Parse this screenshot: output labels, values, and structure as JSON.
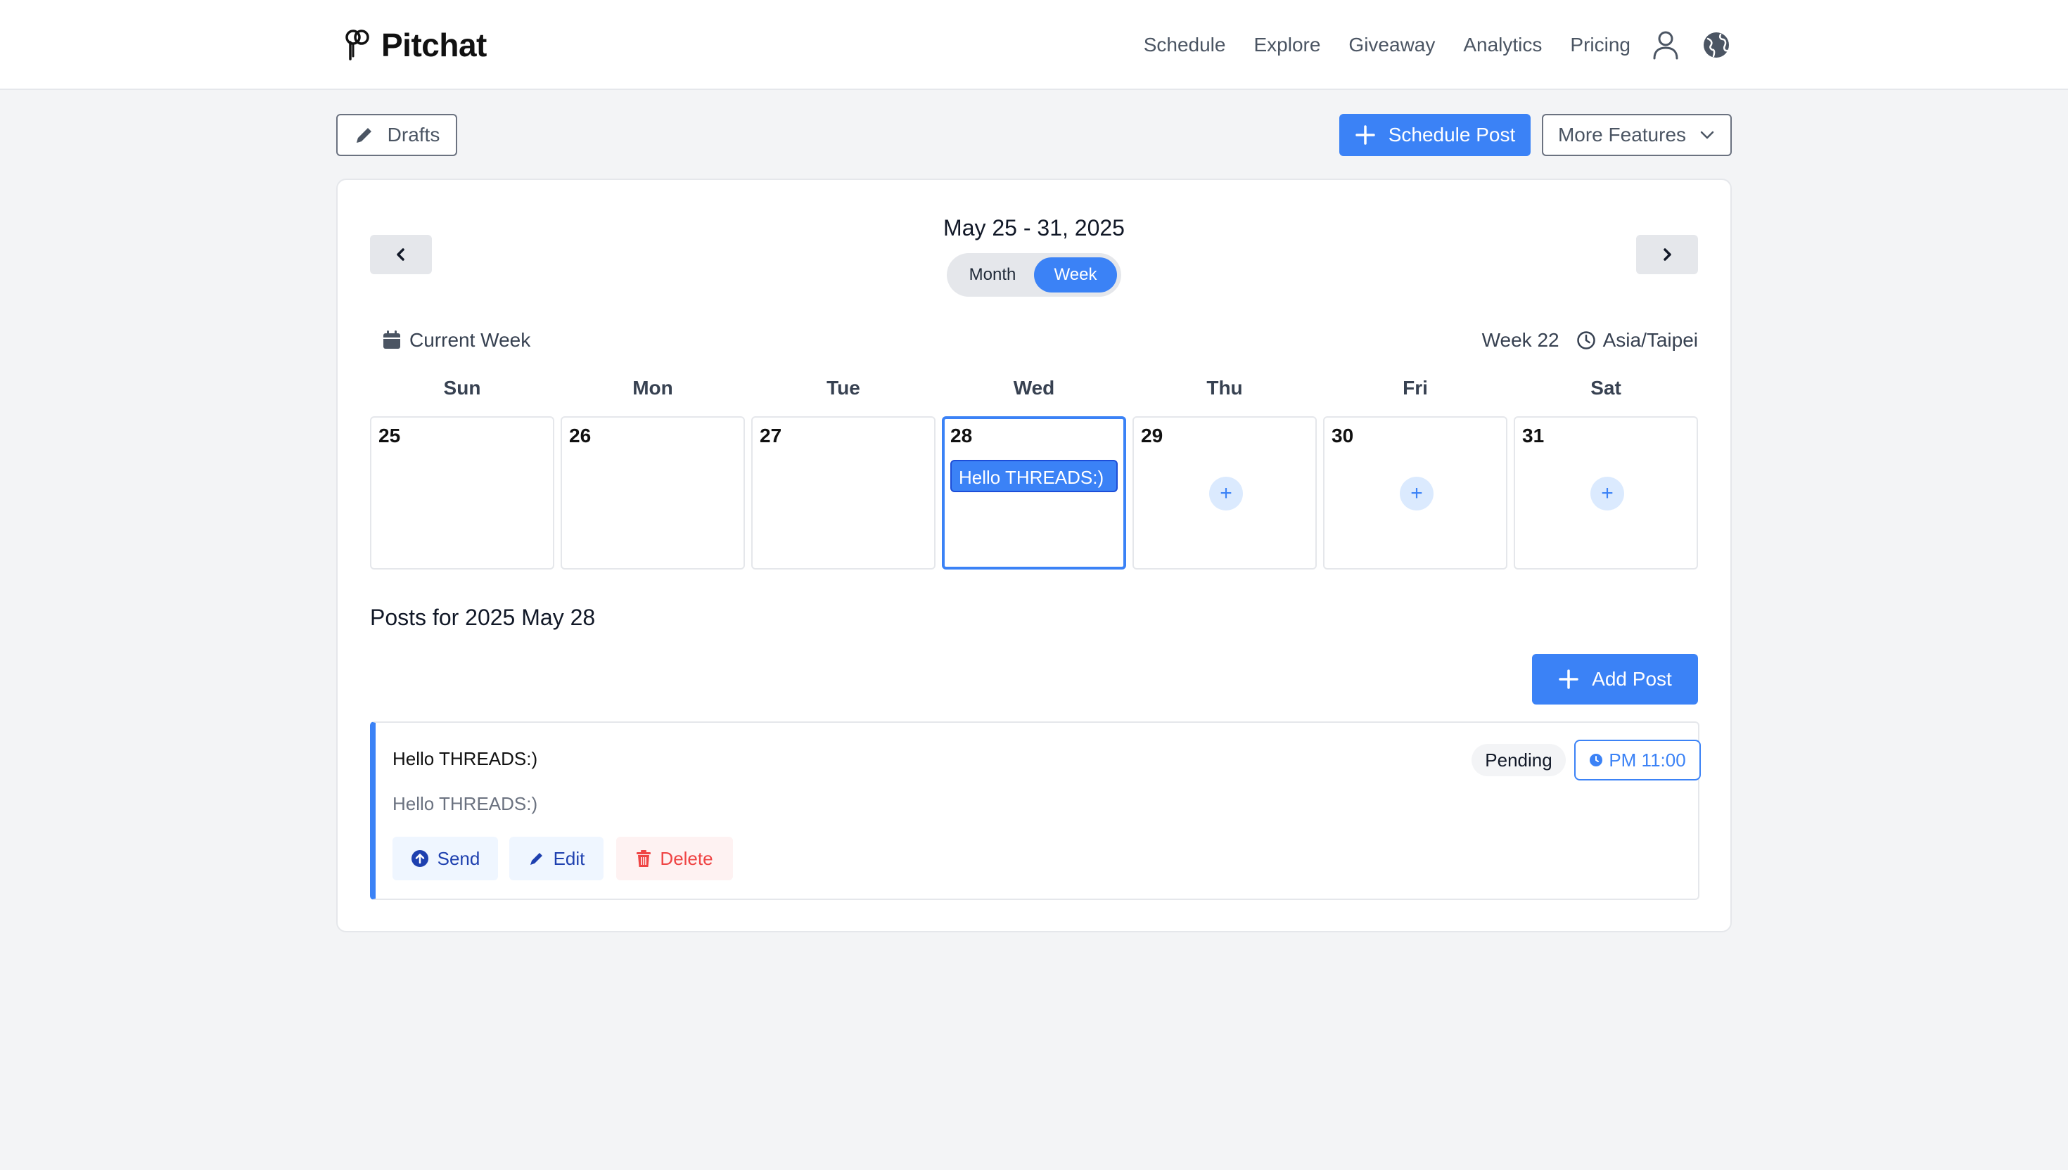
{
  "header": {
    "brand": "Pitchat",
    "nav": [
      "Schedule",
      "Explore",
      "Giveaway",
      "Analytics",
      "Pricing"
    ]
  },
  "toolbar": {
    "drafts_label": "Drafts",
    "schedule_label": "Schedule Post",
    "more_label": "More Features"
  },
  "calendar": {
    "range_title": "May 25 - 31, 2025",
    "view_options": [
      "Month",
      "Week"
    ],
    "active_view": "Week",
    "current_week_label": "Current Week",
    "week_label": "Week 22",
    "timezone": "Asia/Taipei",
    "days": [
      {
        "name": "Sun",
        "date": "25"
      },
      {
        "name": "Mon",
        "date": "26"
      },
      {
        "name": "Tue",
        "date": "27"
      },
      {
        "name": "Wed",
        "date": "28",
        "selected": true,
        "event": "Hello THREADS:)"
      },
      {
        "name": "Thu",
        "date": "29",
        "add": "+"
      },
      {
        "name": "Fri",
        "date": "30",
        "add": "+"
      },
      {
        "name": "Sat",
        "date": "31",
        "add": "+"
      }
    ]
  },
  "posts": {
    "heading": "Posts for 2025 May 28",
    "add_label": "Add Post",
    "items": [
      {
        "title": "Hello THREADS:)",
        "body": "Hello THREADS:)",
        "status": "Pending",
        "time": "PM 11:00",
        "actions": {
          "send": "Send",
          "edit": "Edit",
          "delete": "Delete"
        }
      }
    ]
  },
  "colors": {
    "accent": "#3b82f6",
    "background": "#f3f4f6",
    "danger": "#ef4444"
  }
}
